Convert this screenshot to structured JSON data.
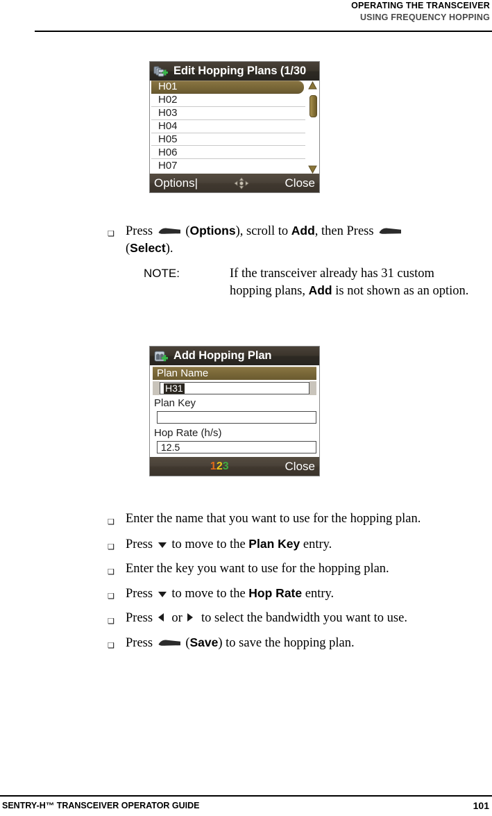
{
  "header": {
    "line1": "OPERATING THE TRANSCEIVER",
    "line2": "USING FREQUENCY HOPPING"
  },
  "footer": {
    "guide": "SENTRY-H™ TRANSCEIVER OPERATOR GUIDE",
    "page": "101"
  },
  "screen_edit": {
    "title": "Edit Hopping Plans (1/30",
    "icon": "edit-hopping-plans-icon",
    "rows": [
      "H01",
      "H02",
      "H03",
      "H04",
      "H05",
      "H06",
      "H07"
    ],
    "selected_row": "H01",
    "softkey_left": "Options|",
    "softkey_mid": "navigation-pad-icon",
    "softkey_right": "Close"
  },
  "screen_add": {
    "title": "Add Hopping Plan",
    "icon": "add-hopping-plan-icon",
    "fields": [
      {
        "label": "Plan Name",
        "value": "H31",
        "highlighted": true
      },
      {
        "label": "Plan Key",
        "value": "",
        "highlighted": false
      },
      {
        "label": "Hop Rate (h/s)",
        "value": "12.5",
        "highlighted": false
      }
    ],
    "softkey_mid": "123",
    "softkey_mid_digits": [
      "1",
      "2",
      "3"
    ],
    "softkey_right": "Close"
  },
  "steps": {
    "step1": {
      "pre": "Press ",
      "mid": " (",
      "options": "Options",
      "after_options": "), scroll to ",
      "add": "Add",
      "then": ", then Press ",
      "line2_open": "(",
      "select": "Select",
      "line2_close": ")."
    },
    "note": {
      "label": "NOTE:",
      "text_1": "If the transceiver already has 31 custom hopping plans, ",
      "bold": "Add",
      "text_2": " is not shown as an option."
    },
    "bullets": [
      {
        "type": "plain",
        "text": "Enter the name that you want to use for the hopping plan."
      },
      {
        "type": "press_down",
        "pre": "Press ",
        "mid": " to move to the ",
        "bold": "Plan Key",
        "post": " entry."
      },
      {
        "type": "plain",
        "text": "Enter the key you want to use for the hopping plan."
      },
      {
        "type": "press_down",
        "pre": "Press ",
        "mid": " to move to the ",
        "bold": "Hop Rate",
        "post": " entry."
      },
      {
        "type": "press_lr",
        "pre": "Press ",
        "mid": " or ",
        "post": " to select the bandwidth you want to use."
      },
      {
        "type": "press_soft",
        "pre": "Press ",
        "open": " (",
        "bold": "Save",
        "close": ") to save the hopping plan."
      }
    ]
  },
  "colors": {
    "ui_brown": "#7a6838",
    "title_dark": "#332e27",
    "digit_1": "#e06a18",
    "digit_2": "#e8c41a",
    "digit_3": "#3faa3f"
  }
}
